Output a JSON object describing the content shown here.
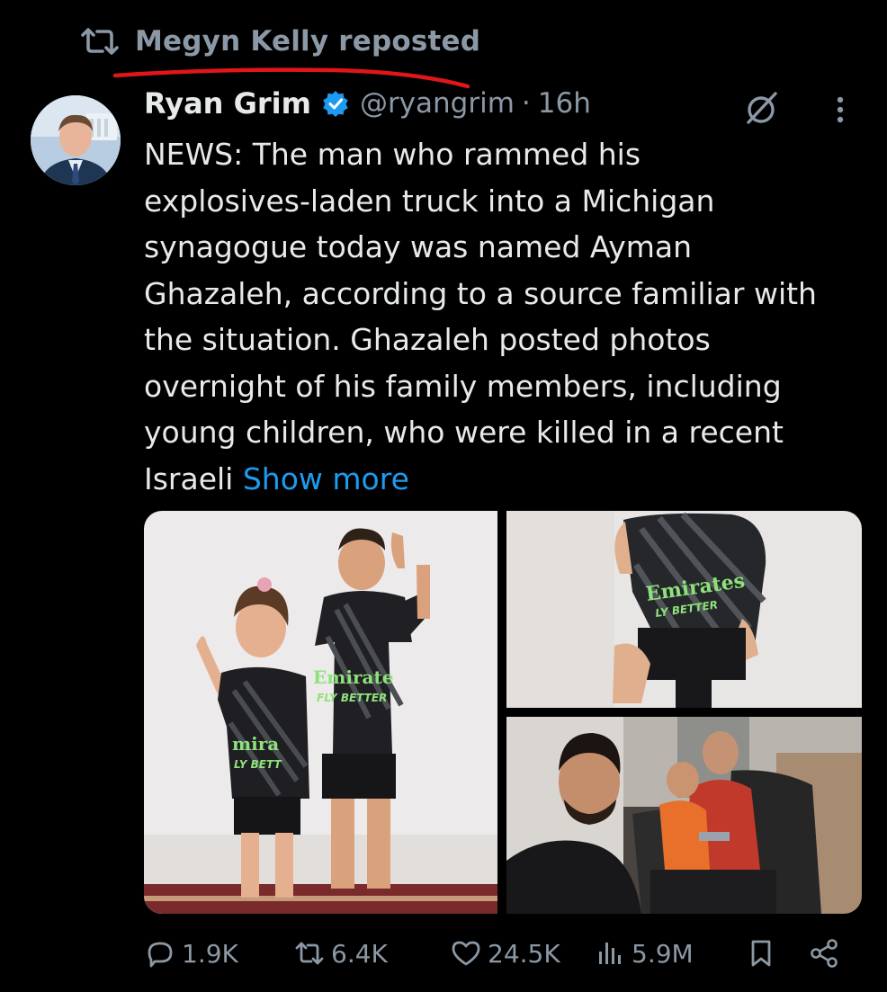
{
  "repost": {
    "label": "Megyn Kelly reposted",
    "icon": "repost-icon"
  },
  "author": {
    "name": "Ryan Grim",
    "handle": "@ryangrim",
    "separator": "·",
    "time": "16h",
    "verified_icon": "verified-badge-icon"
  },
  "post": {
    "text": "NEWS: The man who rammed his\nexplosives-laden truck into a Michigan\nsynagogue today was named Ayman\nGhazaleh, according to a source familiar with\nthe situation. Ghazaleh posted photos\novernight of his family members, including\nyoung children, who were killed in a recent\nIsraeli ",
    "show_more": "Show more"
  },
  "media": {
    "photo_1_jersey_text": "Emirate",
    "photo_1_jersey_sub": "FLY BETTER",
    "photo_1_jersey2_text": "mira",
    "photo_1_jersey2_sub": "LY BETT",
    "photo_2_jersey_text": "Emirates",
    "photo_2_jersey_sub": "LY BETTER"
  },
  "actions": {
    "replies": "1.9K",
    "reposts": "6.4K",
    "likes": "24.5K",
    "views": "5.9M"
  },
  "colors": {
    "background": "#000000",
    "text": "#e7e9ea",
    "muted": "#8b98a5",
    "link": "#1d9bf0",
    "annotation": "#e0161b"
  }
}
